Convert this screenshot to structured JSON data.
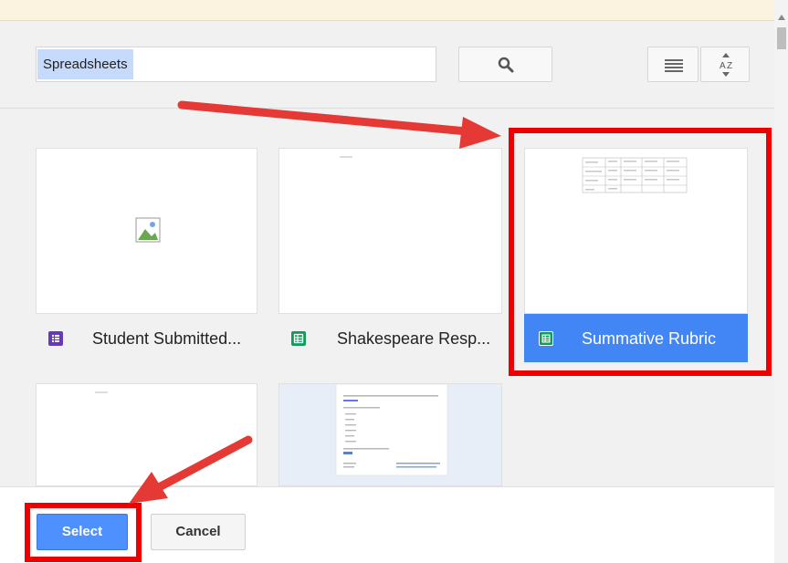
{
  "search": {
    "chip": "Spreadsheets",
    "value": ""
  },
  "toolbar": {
    "search_icon": "search-icon",
    "list_icon": "list-view-icon",
    "sort_icon": "sort-az-icon"
  },
  "files": [
    {
      "title": "Student Submitted...",
      "type": "form",
      "icon": "forms-icon",
      "color": "#673ab7",
      "selected": false
    },
    {
      "title": "Shakespeare Resp...",
      "type": "sheet",
      "icon": "sheets-icon",
      "color": "#0f9d58",
      "selected": false
    },
    {
      "title": "Summative Rubric",
      "type": "sheet",
      "icon": "sheets-icon",
      "color": "#0f9d58",
      "selected": true
    }
  ],
  "footer": {
    "select_label": "Select",
    "cancel_label": "Cancel"
  },
  "colors": {
    "selected": "#4285f4",
    "annotation": "#ee0000",
    "arrow": "#e53935"
  }
}
